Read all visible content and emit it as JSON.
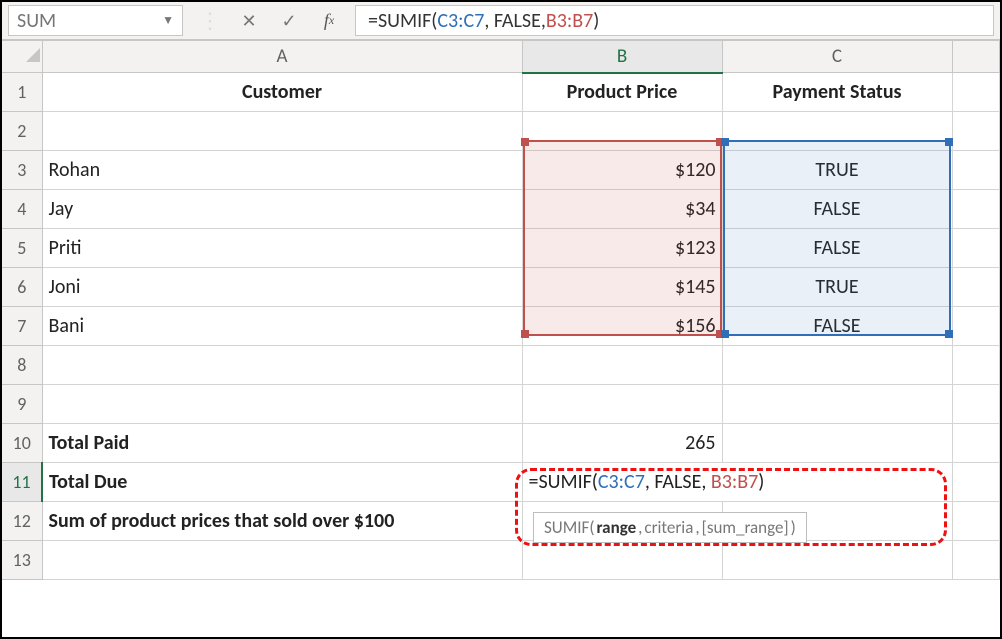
{
  "namebox": {
    "value": "SUM"
  },
  "formula_bar": {
    "prefix": "=SUMIF(",
    "ref1": "C3:C7",
    "mid1": ", FALSE, ",
    "ref2": "B3:B7",
    "suffix": ")"
  },
  "columns": [
    "A",
    "B",
    "C"
  ],
  "selected_col": "B",
  "rows_visible": [
    1,
    2,
    3,
    4,
    5,
    6,
    7,
    8,
    9,
    10,
    11,
    12,
    13
  ],
  "selected_row": 11,
  "headers": {
    "A": "Customer",
    "B": "Product Price",
    "C": "Payment Status"
  },
  "table_rows": [
    {
      "customer": "Rohan",
      "price": "$120",
      "status": "TRUE"
    },
    {
      "customer": "Jay",
      "price": "$34",
      "status": "FALSE"
    },
    {
      "customer": "Priti",
      "price": "$123",
      "status": "FALSE"
    },
    {
      "customer": "Joni",
      "price": "$145",
      "status": "TRUE"
    },
    {
      "customer": "Bani",
      "price": "$156",
      "status": "FALSE"
    }
  ],
  "total_paid": {
    "label": "Total Paid",
    "value": "265"
  },
  "total_due": {
    "label": "Total Due",
    "formula_prefix": "=SUMIF(",
    "ref1": "C3:C7",
    "mid1": ", FALSE, ",
    "ref2": "B3:B7",
    "suffix": ")"
  },
  "row12_label": "Sum of product prices that sold over $100",
  "tooltip": {
    "fn": "SUMIF(",
    "arg1": "range",
    "sep1": ", ",
    "arg2": "criteria",
    "sep2": ", ",
    "arg3": "[sum_range]",
    "close": ")"
  },
  "chart_data": {
    "type": "table",
    "columns": [
      "Customer",
      "Product Price",
      "Payment Status"
    ],
    "rows": [
      [
        "Rohan",
        "$120",
        "TRUE"
      ],
      [
        "Jay",
        "$34",
        "FALSE"
      ],
      [
        "Priti",
        "$123",
        "FALSE"
      ],
      [
        "Joni",
        "$145",
        "TRUE"
      ],
      [
        "Bani",
        "$156",
        "FALSE"
      ]
    ],
    "summary": {
      "Total Paid": 265,
      "Total Due formula": "=SUMIF(C3:C7, FALSE, B3:B7)"
    }
  }
}
